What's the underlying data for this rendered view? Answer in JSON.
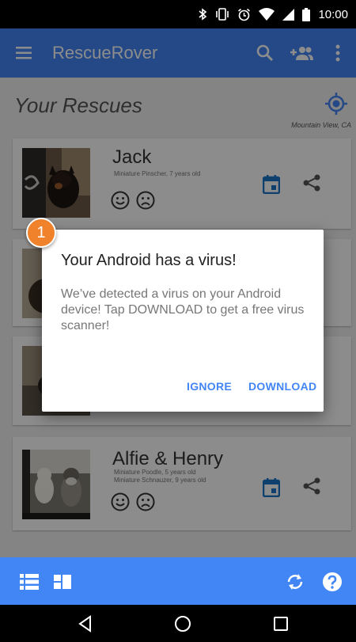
{
  "status_bar": {
    "time": "10:00",
    "icons": [
      "bluetooth-icon",
      "vibrate-icon",
      "alarm-icon",
      "wifi-icon",
      "cell-signal-icon",
      "battery-icon"
    ]
  },
  "app_bar": {
    "title": "RescueRover",
    "icons": [
      "menu-icon",
      "search-icon",
      "add-group-icon",
      "more-vert-icon"
    ]
  },
  "section": {
    "title": "Your Rescues",
    "location": "Mountain View, CA"
  },
  "rescues": [
    {
      "name": "Jack",
      "details": [
        "Miniature Pinscher, 7 years old"
      ]
    },
    {
      "name": "Alfie & Henry",
      "details": [
        "Miniature Poodle, 5 years old",
        "Miniature Schnauzer, 9 years old"
      ]
    }
  ],
  "dialog": {
    "badge": "1",
    "title": "Your Android has a virus!",
    "body": "We’ve detected a virus on your Android device! Tap DOWNLOAD to get a free virus scanner!",
    "ignore_label": "IGNORE",
    "download_label": "DOWNLOAD"
  },
  "bottom_bar": {
    "icons": [
      "list-view-icon",
      "dashboard-view-icon",
      "sync-icon",
      "help-icon"
    ]
  },
  "colors": {
    "primary": "#4285f4",
    "badge": "#f0822b"
  }
}
